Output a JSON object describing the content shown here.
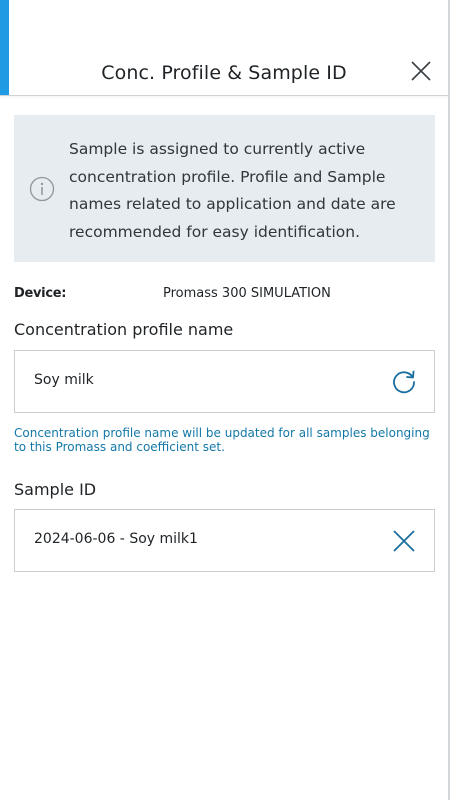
{
  "header": {
    "title": "Conc. Profile & Sample ID",
    "close_icon": "close-icon"
  },
  "info": {
    "icon": "info-icon",
    "text": "Sample is assigned to currently active concentration profile. Profile and Sample names related to application and date are recommended for easy identification."
  },
  "device": {
    "label": "Device:",
    "value": "Promass 300 SIMULATION"
  },
  "concentration_profile": {
    "label": "Concentration profile name",
    "value": "Soy milk",
    "action_icon": "refresh-icon",
    "hint": "Concentration profile name will be updated for all samples belonging to this Promass and coefficient set."
  },
  "sample_id": {
    "label": "Sample ID",
    "value": "2024-06-06 - Soy milk1",
    "action_icon": "clear-icon"
  },
  "colors": {
    "accent": "#1e9be3",
    "info_bg": "#e6ecf0",
    "hint_text": "#1478a8",
    "icon_blue": "#1a6e9e"
  }
}
